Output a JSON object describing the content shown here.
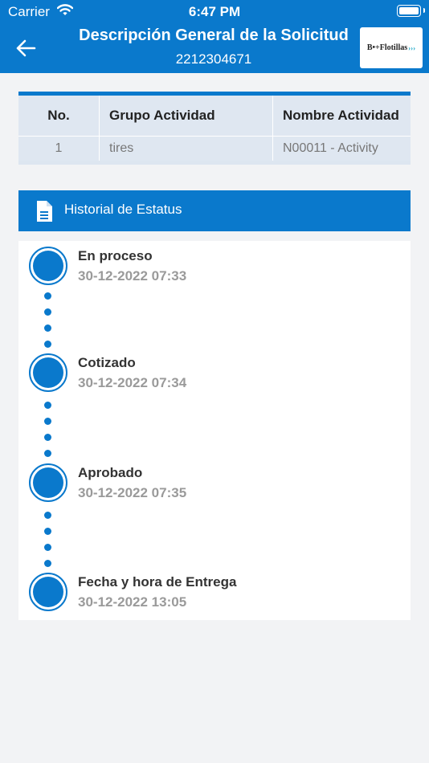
{
  "status_bar": {
    "carrier": "Carrier",
    "time": "6:47 PM"
  },
  "header": {
    "title": "Descripción General de la Solicitud",
    "request_number": "2212304671",
    "logo_text": "B•+Flotillas",
    "logo_chevrons": "›››",
    "back_icon": "arrow-left-icon"
  },
  "table": {
    "columns": [
      "No.",
      "Grupo Actividad",
      "Nombre Actividad"
    ],
    "rows": [
      [
        "1",
        "tires",
        "N00011 - Activity"
      ]
    ]
  },
  "history": {
    "title": "Historial de Estatus",
    "icon": "document-icon",
    "events": [
      {
        "label": "En proceso",
        "timestamp": "30-12-2022 07:33"
      },
      {
        "label": "Cotizado",
        "timestamp": "30-12-2022 07:34"
      },
      {
        "label": "Aprobado",
        "timestamp": "30-12-2022 07:35"
      },
      {
        "label": "Fecha y hora de Entrega",
        "timestamp": "30-12-2022 13:05"
      }
    ]
  },
  "colors": {
    "accent": "#0a79cc",
    "background": "#f2f3f5",
    "table_bg": "#dfe7f1"
  }
}
